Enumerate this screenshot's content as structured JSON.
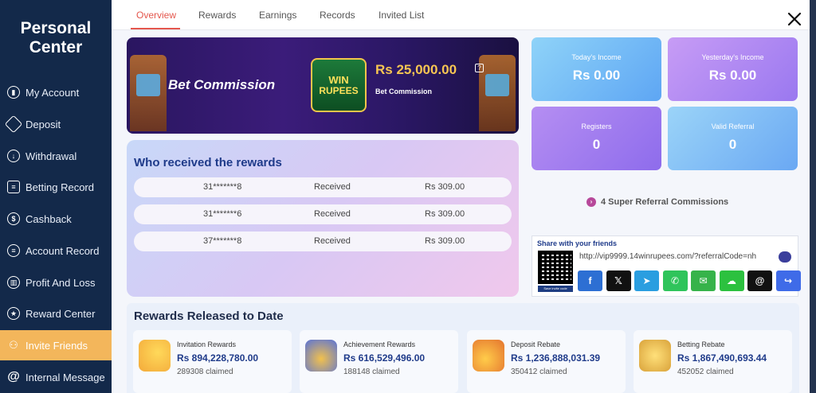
{
  "sidebar": {
    "title_line1": "Personal",
    "title_line2": "Center",
    "items": [
      {
        "label": "My Account",
        "icon": "account-icon"
      },
      {
        "label": "Deposit",
        "icon": "deposit-icon"
      },
      {
        "label": "Withdrawal",
        "icon": "withdrawal-icon"
      },
      {
        "label": "Betting Record",
        "icon": "betting-record-icon"
      },
      {
        "label": "Cashback",
        "icon": "cashback-icon"
      },
      {
        "label": "Account Record",
        "icon": "account-record-icon"
      },
      {
        "label": "Profit And Loss",
        "icon": "profit-loss-icon"
      },
      {
        "label": "Reward Center",
        "icon": "reward-center-icon"
      },
      {
        "label": "Invite Friends",
        "icon": "invite-friends-icon",
        "active": true
      },
      {
        "label": "Internal Message",
        "icon": "message-icon"
      }
    ]
  },
  "tabs": [
    {
      "label": "Overview",
      "active": true
    },
    {
      "label": "Rewards"
    },
    {
      "label": "Earnings"
    },
    {
      "label": "Records"
    },
    {
      "label": "Invited List"
    }
  ],
  "banner": {
    "title": "Bet Commission",
    "logo_line1": "WIN",
    "logo_line2": "RUPEES",
    "amount": "Rs  25,000.00",
    "subtitle": "Bet Commission"
  },
  "who_received": {
    "title": "Who received the rewards",
    "rows": [
      {
        "user": "31*******8",
        "status": "Received",
        "amount": "Rs  309.00"
      },
      {
        "user": "31*******6",
        "status": "Received",
        "amount": "Rs  309.00"
      },
      {
        "user": "37*******8",
        "status": "Received",
        "amount": "Rs  309.00"
      }
    ]
  },
  "stats": {
    "todays_income": {
      "label": "Today's Income",
      "value": "Rs  0.00"
    },
    "yesterdays_income": {
      "label": "Yesterday's Income",
      "value": "Rs  0.00"
    },
    "registers": {
      "label": "Registers",
      "value": "0"
    },
    "valid_referral": {
      "label": "Valid Referral",
      "value": "0"
    }
  },
  "super_referral": "4 Super Referral Commissions",
  "share": {
    "title": "Share with your friends",
    "link": "http://vip9999.14winrupees.com/?referralCode=nh",
    "qr_caption": "Save invite code",
    "socials": [
      {
        "name": "facebook-icon",
        "glyph": "f",
        "color": "#2d6fd3"
      },
      {
        "name": "x-icon",
        "glyph": "𝕏",
        "color": "#111111"
      },
      {
        "name": "telegram-icon",
        "glyph": "➤",
        "color": "#2a9ee0"
      },
      {
        "name": "whatsapp-icon",
        "glyph": "✆",
        "color": "#2fc45b"
      },
      {
        "name": "sms-icon",
        "glyph": "✉",
        "color": "#36b34a"
      },
      {
        "name": "line-icon",
        "glyph": "☁",
        "color": "#2cc13f"
      },
      {
        "name": "threads-icon",
        "glyph": "@",
        "color": "#111111"
      },
      {
        "name": "share-icon",
        "glyph": "↪",
        "color": "#3f6be8"
      }
    ]
  },
  "released": {
    "title": "Rewards Released to Date",
    "cards": [
      {
        "label": "Invitation Rewards",
        "value": "Rs  894,228,780.00",
        "claimed": "289308 claimed",
        "icon": "invitation-reward-icon",
        "color": "#f6c244"
      },
      {
        "label": "Achievement Rewards",
        "value": "Rs  616,529,496.00",
        "claimed": "188148 claimed",
        "icon": "achievement-medal-icon",
        "color": "#5872d8"
      },
      {
        "label": "Deposit Rebate",
        "value": "Rs  1,236,888,031.39",
        "claimed": "350412 claimed",
        "icon": "deposit-rebate-icon",
        "color": "#f0a33a"
      },
      {
        "label": "Betting Rebate",
        "value": "Rs  1,867,490,693.44",
        "claimed": "452052 claimed",
        "icon": "betting-rebate-icon",
        "color": "#e9b840"
      }
    ]
  }
}
